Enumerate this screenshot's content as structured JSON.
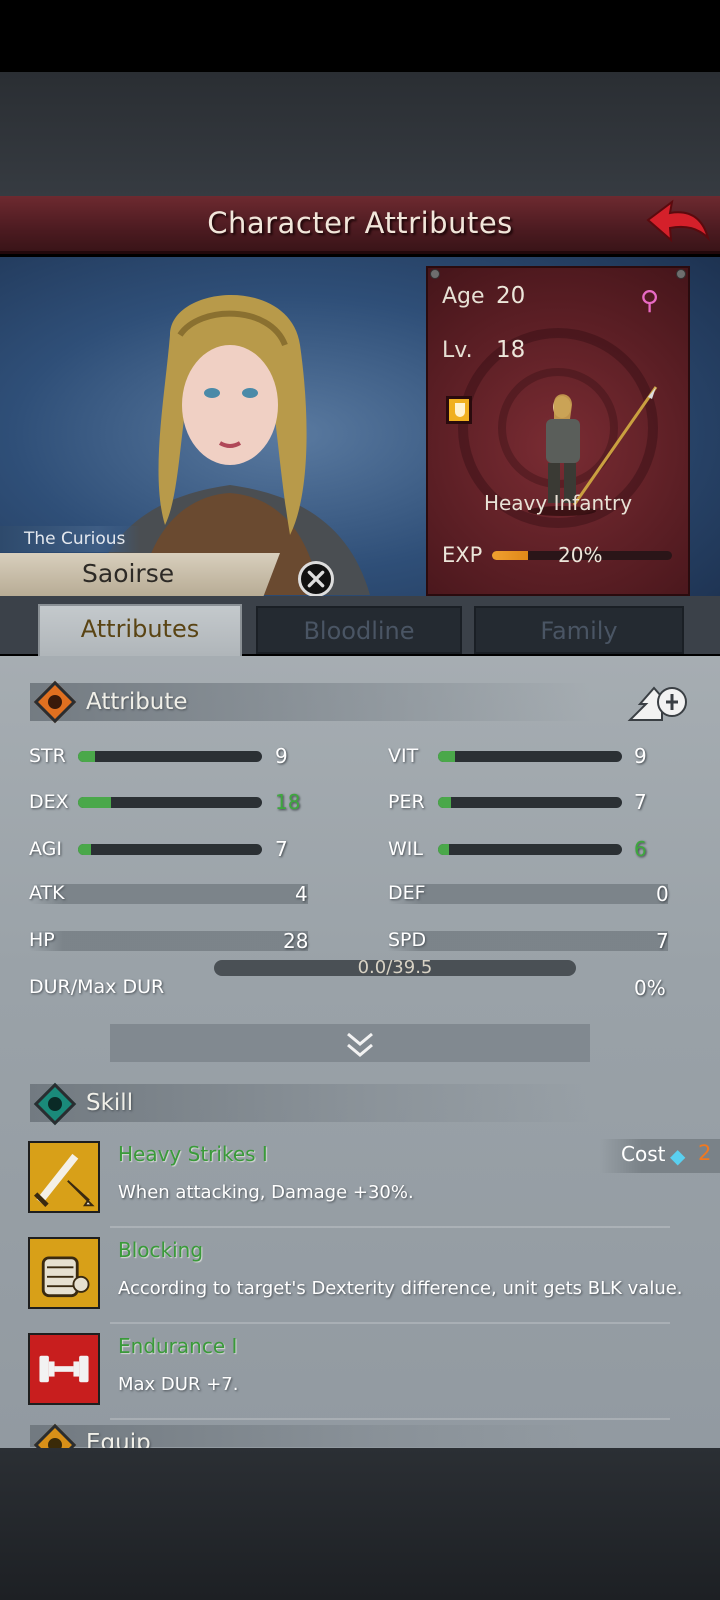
{
  "header": {
    "title": "Character Attributes",
    "back_icon": "back-arrow-icon"
  },
  "character": {
    "epithet": "The Curious",
    "name": "Saoirse",
    "age_label": "Age",
    "age": "20",
    "gender_icon": "female-symbol-icon",
    "level_label": "Lv.",
    "level": "18",
    "class_icon": "shield-class-icon",
    "class_name": "Heavy Infantry",
    "exp_label": "EXP",
    "exp_percent_text": "20%",
    "exp_fraction": 0.2
  },
  "tabs": [
    {
      "label": "Attributes",
      "active": true
    },
    {
      "label": "Bloodline",
      "active": false
    },
    {
      "label": "Family",
      "active": false
    }
  ],
  "attribute_section": {
    "title": "Attribute",
    "icon": "attribute-icon",
    "action_icon": "upgrade-attributes-icon"
  },
  "primary_stats": [
    {
      "label": "STR",
      "value": "9",
      "fill": 0.09,
      "color": "white"
    },
    {
      "label": "VIT",
      "value": "9",
      "fill": 0.09,
      "color": "white"
    },
    {
      "label": "DEX",
      "value": "18",
      "fill": 0.18,
      "color": "green"
    },
    {
      "label": "PER",
      "value": "7",
      "fill": 0.07,
      "color": "white"
    },
    {
      "label": "AGI",
      "value": "7",
      "fill": 0.07,
      "color": "white"
    },
    {
      "label": "WIL",
      "value": "6",
      "fill": 0.06,
      "color": "green"
    }
  ],
  "secondary_stats": [
    {
      "label": "ATK",
      "value": "4"
    },
    {
      "label": "DEF",
      "value": "0"
    },
    {
      "label": "HP",
      "value": "28"
    },
    {
      "label": "SPD",
      "value": "7"
    }
  ],
  "durability": {
    "label": "DUR/Max DUR",
    "value": "0.0/39.5",
    "percent": "0%"
  },
  "expand_icon": "double-chevron-down-icon",
  "skill_section": {
    "title": "Skill",
    "icon": "skill-icon",
    "cost_label": "Cost",
    "cost_icon": "diamond-gem-icon",
    "cost_value": "2",
    "skills": [
      {
        "name": "Heavy Strikes I",
        "desc": "When attacking, Damage +30%.",
        "icon": "sword-strike-icon"
      },
      {
        "name": "Blocking",
        "desc": "According to target's Dexterity difference, unit gets BLK value.",
        "icon": "gauntlet-block-icon"
      },
      {
        "name": "Endurance I",
        "desc": "Max DUR +7.",
        "icon": "dumbbell-icon"
      }
    ]
  },
  "equip_section": {
    "title": "Equip",
    "icon": "equip-icon"
  },
  "colors": {
    "header": "#6e2a30",
    "panel": "#9aa2a8",
    "accent_green": "#3ea83e",
    "accent_orange": "#f07820"
  }
}
